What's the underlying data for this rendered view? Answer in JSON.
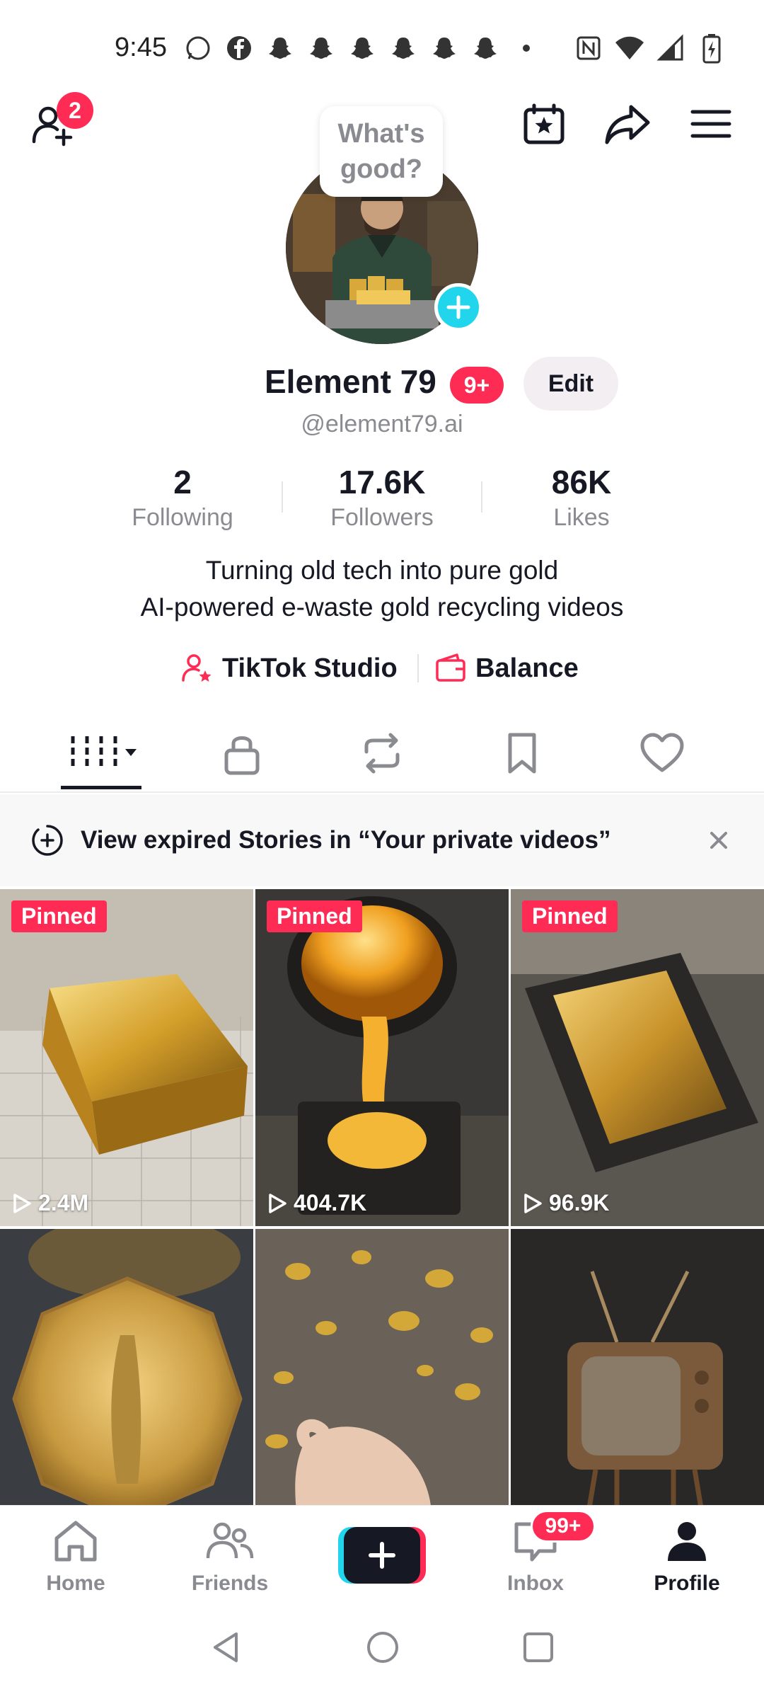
{
  "status_bar": {
    "time": "9:45"
  },
  "top_bar": {
    "friend_requests_badge": "2"
  },
  "avatar": {
    "bubble_text_line1": "What's",
    "bubble_text_line2": "good?"
  },
  "profile": {
    "display_name": "Element 79",
    "name_badge": "9+",
    "edit_label": "Edit",
    "username": "@element79.ai"
  },
  "stats": [
    {
      "value": "2",
      "label": "Following"
    },
    {
      "value": "17.6K",
      "label": "Followers"
    },
    {
      "value": "86K",
      "label": "Likes"
    }
  ],
  "bio": {
    "line1": "Turning old tech into pure gold",
    "line2": "AI-powered e-waste gold recycling videos"
  },
  "links": {
    "studio": "TikTok Studio",
    "balance": "Balance"
  },
  "banner": {
    "text": "View expired Stories in “Your private videos”"
  },
  "videos": [
    {
      "pinned": "Pinned",
      "views": "2.4M"
    },
    {
      "pinned": "Pinned",
      "views": "404.7K"
    },
    {
      "pinned": "Pinned",
      "views": "96.9K"
    },
    {
      "pinned": "",
      "views": ""
    },
    {
      "pinned": "",
      "views": ""
    },
    {
      "pinned": "",
      "views": ""
    }
  ],
  "bottom_nav": {
    "home": "Home",
    "friends": "Friends",
    "inbox": "Inbox",
    "inbox_badge": "99+",
    "profile": "Profile"
  },
  "colors": {
    "accent": "#fe2c55",
    "cyan": "#20d5ec",
    "text": "#161823",
    "muted": "#8a8b91"
  }
}
